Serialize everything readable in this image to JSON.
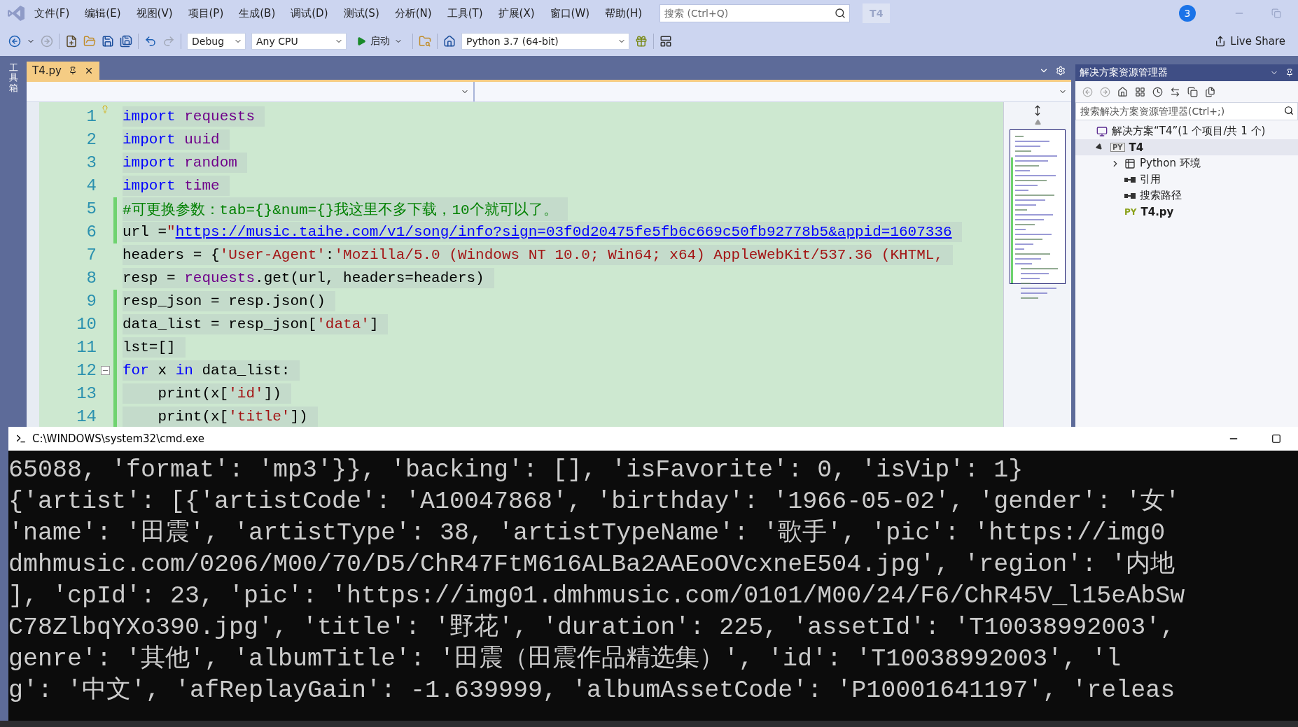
{
  "window": {
    "title_badge": "T4",
    "search": {
      "placeholder": "搜索 (Ctrl+Q)"
    },
    "notifications": "3"
  },
  "menu": [
    "文件(F)",
    "编辑(E)",
    "视图(V)",
    "项目(P)",
    "生成(B)",
    "调试(D)",
    "测试(S)",
    "分析(N)",
    "工具(T)",
    "扩展(X)",
    "窗口(W)",
    "帮助(H)"
  ],
  "toolbar": {
    "configuration": "Debug",
    "platform": "Any CPU",
    "start": "启动",
    "environment": "Python 3.7 (64-bit)",
    "live_share": "Live Share"
  },
  "toolbox": {
    "label": "工具箱"
  },
  "tabs": [
    {
      "label": "T4.py",
      "selected": true
    }
  ],
  "editor": {
    "lines": [
      {
        "number": "1",
        "modified": false,
        "lightbulb": true,
        "segments": [
          {
            "text": "import",
            "kind": "keyword"
          },
          {
            "text": " requests",
            "kind": "module"
          }
        ]
      },
      {
        "number": "2",
        "modified": false,
        "segments": [
          {
            "text": "import",
            "kind": "keyword"
          },
          {
            "text": " uuid",
            "kind": "module"
          }
        ]
      },
      {
        "number": "3",
        "modified": false,
        "segments": [
          {
            "text": "import",
            "kind": "keyword"
          },
          {
            "text": " random",
            "kind": "module"
          }
        ]
      },
      {
        "number": "4",
        "modified": false,
        "segments": [
          {
            "text": "import",
            "kind": "keyword"
          },
          {
            "text": " time",
            "kind": "module"
          }
        ]
      },
      {
        "number": "5",
        "modified": true,
        "segments": [
          {
            "text": "#可更换参数：tab={}&num={}我这里不多下载，10个就可以了。",
            "kind": "comment"
          }
        ]
      },
      {
        "number": "6",
        "modified": true,
        "segments": [
          {
            "text": "url =",
            "kind": "plain"
          },
          {
            "text": "\"",
            "kind": "string"
          },
          {
            "text": "https://music.taihe.com/v1/song/info?sign=03f0d20475fe5fb6c669c50fb92778b5&appid=1607336",
            "kind": "link"
          }
        ]
      },
      {
        "number": "7",
        "modified": false,
        "segments": [
          {
            "text": "headers = {",
            "kind": "plain"
          },
          {
            "text": "'User-Agent'",
            "kind": "string"
          },
          {
            "text": ":",
            "kind": "plain"
          },
          {
            "text": "'Mozilla/5.0 (Windows NT 10.0; Win64; x64) AppleWebKit/537.36 (KHTML,",
            "kind": "string"
          }
        ]
      },
      {
        "number": "8",
        "modified": false,
        "segments": [
          {
            "text": "resp = ",
            "kind": "plain"
          },
          {
            "text": "requests",
            "kind": "module"
          },
          {
            "text": ".get(url, headers=headers)",
            "kind": "plain"
          }
        ]
      },
      {
        "number": "9",
        "modified": true,
        "segments": [
          {
            "text": "resp_json = resp.json()",
            "kind": "plain"
          }
        ]
      },
      {
        "number": "10",
        "modified": true,
        "segments": [
          {
            "text": "data_list = resp_json[",
            "kind": "plain"
          },
          {
            "text": "'data'",
            "kind": "string"
          },
          {
            "text": "]",
            "kind": "plain"
          }
        ]
      },
      {
        "number": "11",
        "modified": true,
        "segments": [
          {
            "text": "lst=[]",
            "kind": "plain"
          }
        ]
      },
      {
        "number": "12",
        "modified": true,
        "fold_marker": true,
        "segments": [
          {
            "text": "for",
            "kind": "keyword"
          },
          {
            "text": " x ",
            "kind": "plain"
          },
          {
            "text": "in",
            "kind": "keyword"
          },
          {
            "text": " data_list:",
            "kind": "plain"
          }
        ]
      },
      {
        "number": "13",
        "modified": true,
        "segments": [
          {
            "text": "    print(x[",
            "kind": "plain"
          },
          {
            "text": "'id'",
            "kind": "string"
          },
          {
            "text": "])",
            "kind": "plain"
          }
        ]
      },
      {
        "number": "14",
        "modified": true,
        "segments": [
          {
            "text": "    print(x[",
            "kind": "plain"
          },
          {
            "text": "'title'",
            "kind": "string"
          },
          {
            "text": "])",
            "kind": "plain"
          }
        ]
      }
    ]
  },
  "solution_explorer": {
    "title": "解决方案资源管理器",
    "search": {
      "placeholder": "搜索解决方案资源管理器(Ctrl+;)"
    },
    "tree": [
      {
        "label": "解决方案“T4”(1 个项目/共 1 个)",
        "kind": "solution",
        "selected": false,
        "children": [
          {
            "label": "T4",
            "kind": "project",
            "badge": "PY",
            "selected": true,
            "expanded": true,
            "children": [
              {
                "label": "Python 环境",
                "kind": "environments",
                "selected": false,
                "expanded": false
              },
              {
                "label": "引用",
                "kind": "references",
                "selected": false
              },
              {
                "label": "搜索路径",
                "kind": "search-paths",
                "selected": false
              },
              {
                "label": "T4.py",
                "kind": "file",
                "badge": "PY",
                "selected": false
              }
            ]
          }
        ]
      }
    ]
  },
  "console": {
    "title": "C:\\WINDOWS\\system32\\cmd.exe",
    "lines": [
      "65088, 'format': 'mp3'}}, 'backing': [], 'isFavorite': 0, 'isVip': 1}",
      "{'artist': [{'artistCode': 'A10047868', 'birthday': '1966-05-02', 'gender': '女'",
      "'name': '田震', 'artistType': 38, 'artistTypeName': '歌手', 'pic': 'https://img0",
      "dmhmusic.com/0206/M00/70/D5/ChR47FtM616ALBa2AAEoOVcxneE504.jpg', 'region': '内地",
      "], 'cpId': 23, 'pic': 'https://img01.dmhmusic.com/0101/M00/24/F6/ChR45V_l15eAbSw",
      "C78ZlbqYXo390.jpg', 'title': '野花', 'duration': 225, 'assetId': 'T10038992003',",
      "genre': '其他', 'albumTitle': '田震（田震作品精选集）', 'id': 'T10038992003', 'l",
      "g': '中文', 'afReplayGain': -1.639999, 'albumAssetCode': 'P10001641197', 'releas"
    ]
  }
}
